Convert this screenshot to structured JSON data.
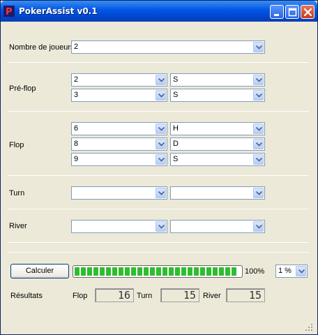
{
  "window": {
    "title": "PokerAssist v0.1",
    "icon_letter": "P"
  },
  "players": {
    "label": "Nombre de joueurs:",
    "value": "2"
  },
  "preflop": {
    "label": "Pré-flop",
    "cards": [
      {
        "rank": "2",
        "suit": "S"
      },
      {
        "rank": "3",
        "suit": "S"
      }
    ]
  },
  "flop": {
    "label": "Flop",
    "cards": [
      {
        "rank": "6",
        "suit": "H"
      },
      {
        "rank": "8",
        "suit": "D"
      },
      {
        "rank": "9",
        "suit": "S"
      }
    ]
  },
  "turn": {
    "label": "Turn",
    "rank": "",
    "suit": ""
  },
  "river": {
    "label": "River",
    "rank": "",
    "suit": ""
  },
  "calc": {
    "button_label": "Calculer",
    "progress_percent": 100,
    "progress_text": "100%",
    "precision": "1 %"
  },
  "results": {
    "label": "Résultats",
    "flop_label": "Flop",
    "flop_value": "16",
    "turn_label": "Turn",
    "turn_value": "15",
    "river_label": "River",
    "river_value": "15"
  },
  "colors": {
    "titlebar": "#0055e5",
    "progress_fill": "#2fbd2f",
    "background": "#ece9d8"
  }
}
